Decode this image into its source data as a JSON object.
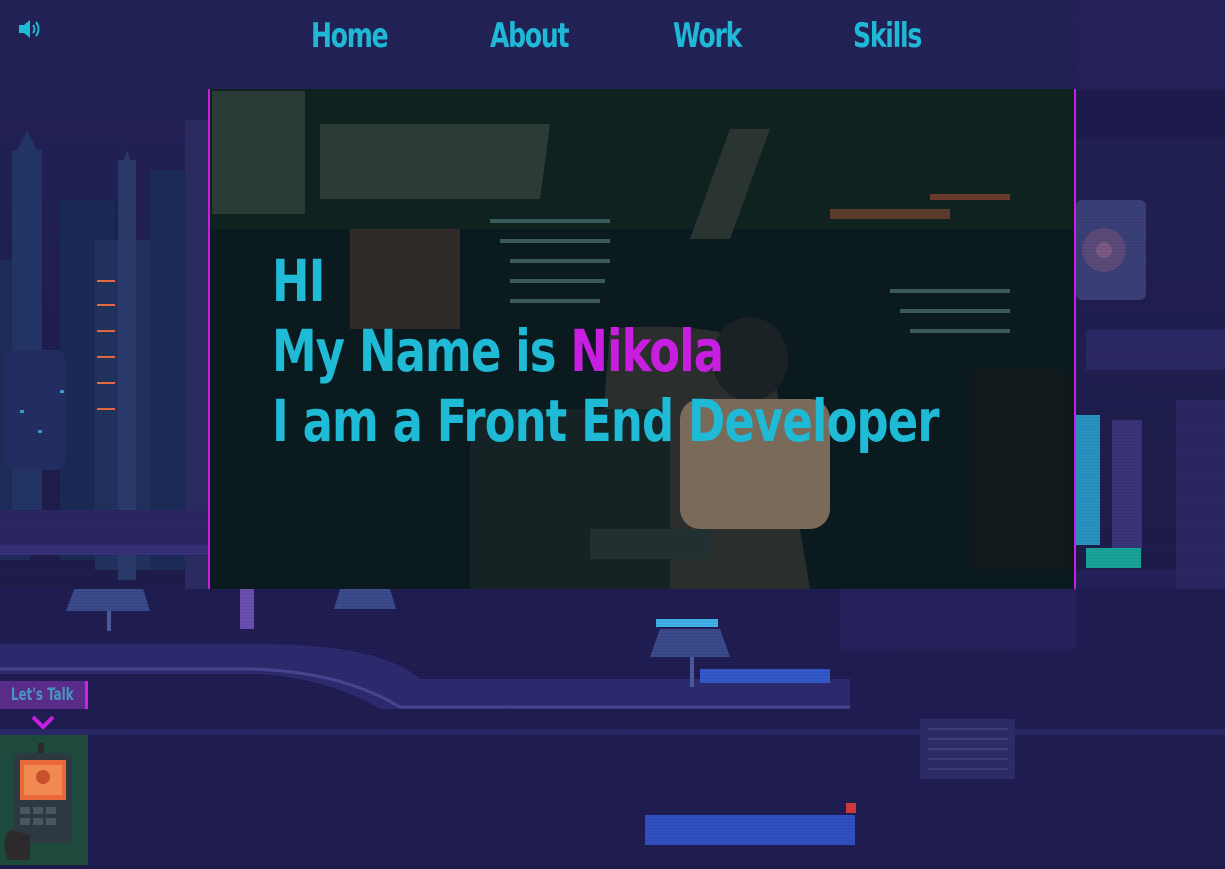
{
  "nav": {
    "items": [
      {
        "label": "Home"
      },
      {
        "label": "About"
      },
      {
        "label": "Work"
      },
      {
        "label": "Skills"
      }
    ]
  },
  "sound": {
    "icon": "speaker-icon"
  },
  "hero": {
    "greeting": "HI",
    "name_prefix": "My Name is ",
    "name": "Nikola",
    "role": "I am a Front End Developer"
  },
  "contact": {
    "button_label": "Let's Talk",
    "toggle_icon": "chevron-down-icon",
    "device_icon": "radio-icon"
  },
  "colors": {
    "accent_cyan": "#1fbad6",
    "accent_magenta": "#c81ee0",
    "background": "#1d1c4a"
  }
}
